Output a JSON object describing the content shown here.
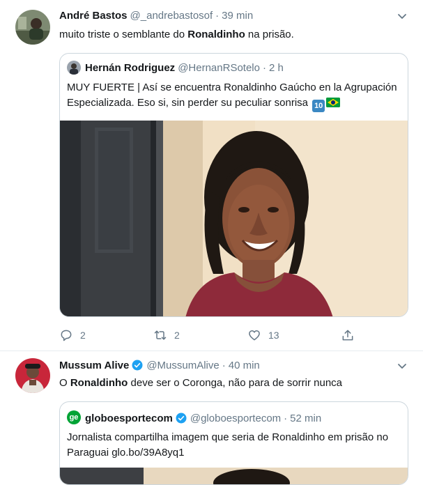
{
  "tweets": [
    {
      "display_name": "André Bastos",
      "handle": "@_andrebastosof",
      "time": "39 min",
      "text_before": "muito triste o semblante do ",
      "text_bold": "Ronaldinho",
      "text_after": " na prisão.",
      "quoted": {
        "display_name": "Hernán Rodriguez",
        "handle": "@HernanRSotelo",
        "time": "2 h",
        "line1": "MUY FUERTE | Así se encuentra Ronaldinho Gaúcho en la Agrupación",
        "line2": "Especializada. Eso si, sin perder su peculiar sonrisa",
        "emoji_10": "10"
      },
      "actions": {
        "replies": "2",
        "retweets": "2",
        "likes": "13"
      }
    },
    {
      "display_name": "Mussum Alive",
      "handle": "@MussumAlive",
      "time": "40 min",
      "text_before": "O ",
      "text_bold": "Ronaldinho",
      "text_after": " deve ser o Coronga, não para de sorrir nunca",
      "quoted": {
        "avatar_letters": "ge",
        "display_name": "globoesportecom",
        "handle": "@globoesportecom",
        "time": "52 min",
        "line1": "Jornalista compartilha imagem que seria de Ronaldinho em prisão no",
        "line2": "Paraguai glo.bo/39A8yq1"
      }
    }
  ],
  "separator": "·",
  "colors": {
    "secondary_text": "#657786",
    "border": "#ccd6dd",
    "verified_blue": "#1da1f2",
    "globo_green": "#00a335"
  }
}
